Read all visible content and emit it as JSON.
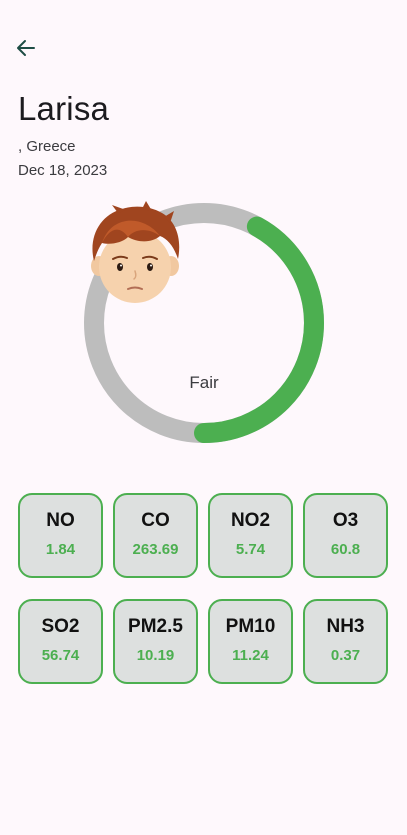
{
  "header": {
    "back_icon": "arrow-left-icon",
    "city": "Larisa",
    "location": ", Greece",
    "date": "Dec 18, 2023"
  },
  "aqi": {
    "status": "Fair",
    "level_fraction": 0.42,
    "face_icon": "boy-face-icon",
    "colors": {
      "progress": "#4caf50",
      "track": "#bdbdbd"
    }
  },
  "pollutants": [
    {
      "name": "NO",
      "value": "1.84"
    },
    {
      "name": "CO",
      "value": "263.69"
    },
    {
      "name": "NO2",
      "value": "5.74"
    },
    {
      "name": "O3",
      "value": "60.8"
    },
    {
      "name": "SO2",
      "value": "56.74"
    },
    {
      "name": "PM2.5",
      "value": "10.19"
    },
    {
      "name": "PM10",
      "value": "11.24"
    },
    {
      "name": "NH3",
      "value": "0.37"
    }
  ]
}
